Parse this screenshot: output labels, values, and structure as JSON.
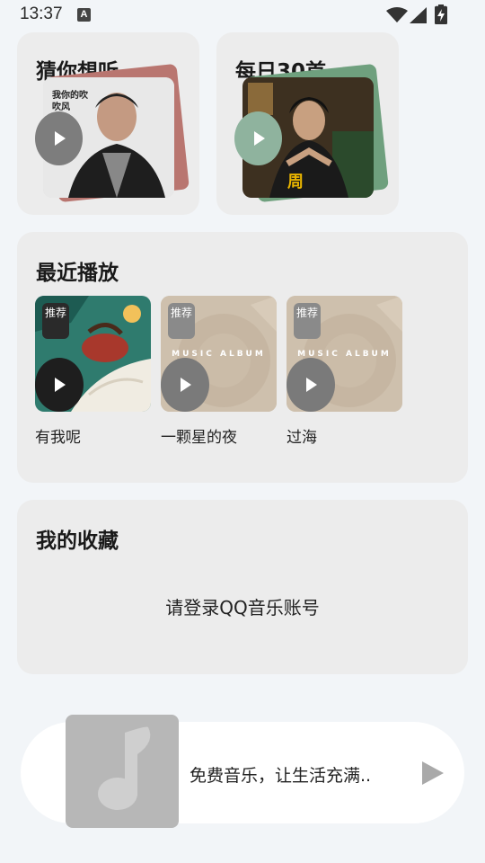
{
  "status_bar": {
    "time": "13:37",
    "notification_badge": "A"
  },
  "cards": {
    "guess": {
      "title": "猜你想听",
      "cover_caption": "我你的吹吹风"
    },
    "daily": {
      "title": "每日30首",
      "cover_caption": "周"
    }
  },
  "recent": {
    "title": "最近播放",
    "items": [
      {
        "title": "有我呢",
        "tag": "推荐",
        "album_text": ""
      },
      {
        "title": "一颗星的夜",
        "tag": "推荐",
        "album_text": "MUSIC ALBUM"
      },
      {
        "title": "过海",
        "tag": "推荐",
        "album_text": "MUSIC ALBUM"
      }
    ]
  },
  "favorites": {
    "title": "我的收藏",
    "login_prompt": "请登录QQ音乐账号"
  },
  "player": {
    "now_playing": "免费音乐，让生活充满.."
  },
  "icons": {
    "play": "play-icon",
    "music_note": "music-note-icon",
    "wifi": "wifi-icon",
    "signal": "signal-icon",
    "battery": "battery-charging-icon"
  },
  "colors": {
    "background": "#f2f5f8",
    "card": "#ececec",
    "guess_back": "#b97670",
    "daily_back": "#6fa07e",
    "daily_play": "#8fb39e"
  }
}
